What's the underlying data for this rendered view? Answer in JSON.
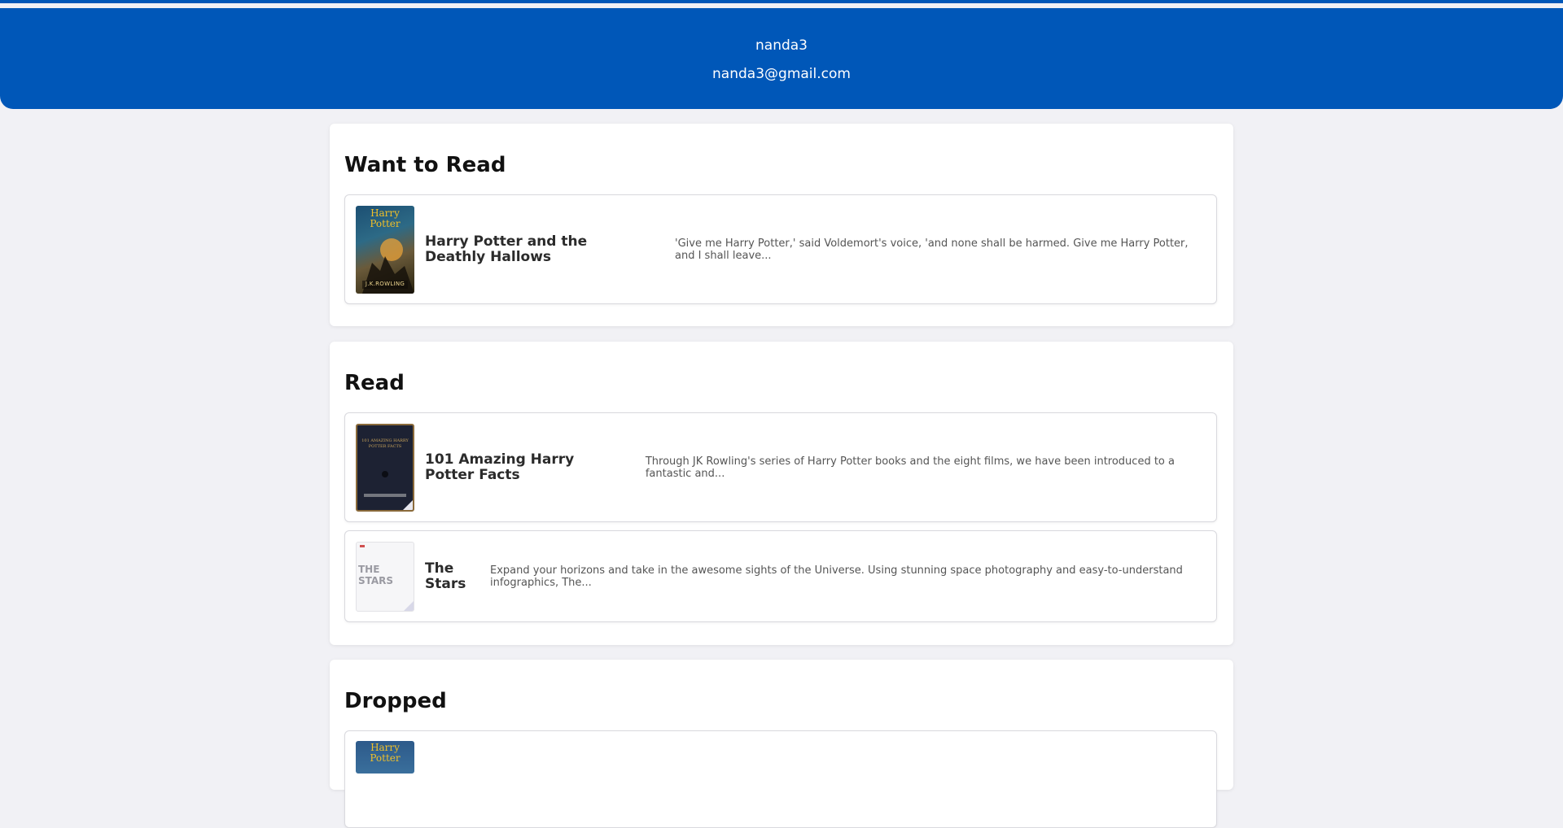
{
  "profile": {
    "username": "nanda3",
    "email": "nanda3@gmail.com"
  },
  "sections": [
    {
      "title": "Want to Read",
      "books": [
        {
          "title": "Harry Potter and the Deathly Hallows",
          "description": "'Give me Harry Potter,' said Voldemort's voice, 'and none shall be harmed. Give me Harry Potter, and I shall leave...",
          "cover_title": "Harry Potter",
          "cover_author": "J.K.ROWLING"
        }
      ]
    },
    {
      "title": "Read",
      "books": [
        {
          "title": "101 Amazing Harry Potter Facts",
          "description": "Through JK Rowling's series of Harry Potter books and the eight films, we have been introduced to a fantastic and...",
          "cover_title": "101 AMAZING HARRY POTTER FACTS"
        },
        {
          "title": "The Stars",
          "description": "Expand your horizons and take in the awesome sights of the Universe. Using stunning space photography and easy-to-understand infographics, The...",
          "cover_title": "THE STARS"
        }
      ]
    },
    {
      "title": "Dropped",
      "books": [
        {
          "cover_title": "Harry Potter"
        }
      ]
    }
  ],
  "colors": {
    "header_bg": "#0057b8",
    "page_bg": "#f1f1f5"
  }
}
